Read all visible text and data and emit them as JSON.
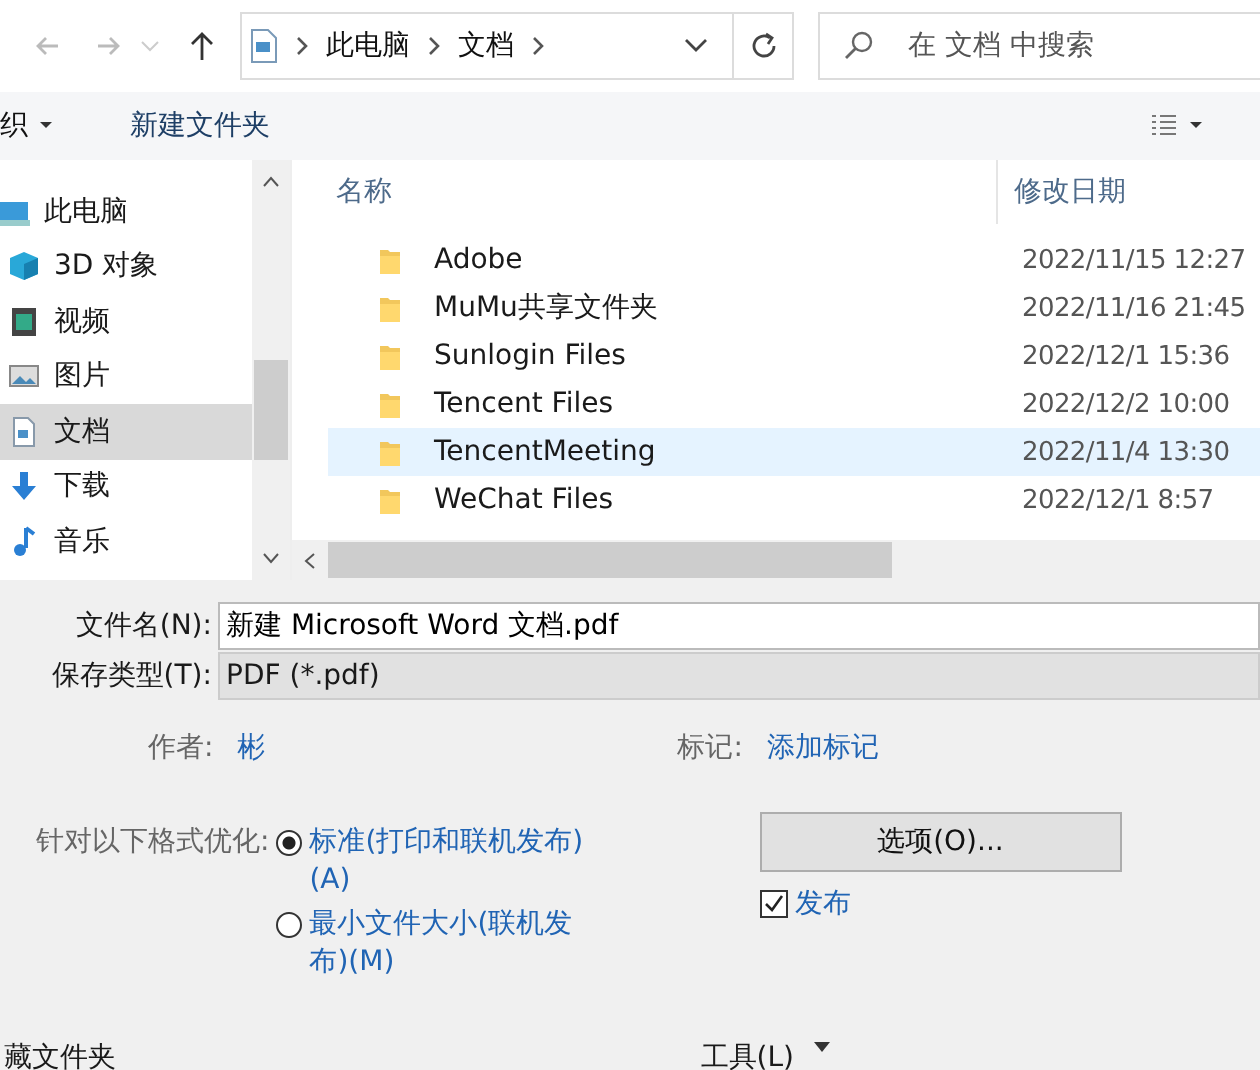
{
  "address_bar": {
    "path": [
      "此电脑",
      "文档"
    ],
    "search_placeholder": "在 文档 中搜索"
  },
  "toolbar": {
    "organize": "织",
    "new_folder": "新建文件夹"
  },
  "sidebar": {
    "items": [
      {
        "label": "此电脑",
        "kind": "pc",
        "selected": false
      },
      {
        "label": "3D 对象",
        "kind": "cube",
        "selected": false
      },
      {
        "label": "视频",
        "kind": "video",
        "selected": false
      },
      {
        "label": "图片",
        "kind": "image",
        "selected": false
      },
      {
        "label": "文档",
        "kind": "doc",
        "selected": true
      },
      {
        "label": "下载",
        "kind": "download",
        "selected": false
      },
      {
        "label": "音乐",
        "kind": "music",
        "selected": false
      }
    ]
  },
  "file_list": {
    "columns": [
      "名称",
      "修改日期"
    ],
    "rows": [
      {
        "name": "Adobe",
        "modified": "2022/11/15 12:27",
        "selected": false
      },
      {
        "name": "MuMu共享文件夹",
        "modified": "2022/11/16 21:45",
        "selected": false
      },
      {
        "name": "Sunlogin Files",
        "modified": "2022/12/1 15:36",
        "selected": false
      },
      {
        "name": "Tencent Files",
        "modified": "2022/12/2 10:00",
        "selected": false
      },
      {
        "name": "TencentMeeting",
        "modified": "2022/11/4 13:30",
        "selected": true
      },
      {
        "name": "WeChat Files",
        "modified": "2022/12/1 8:57",
        "selected": false
      }
    ]
  },
  "form": {
    "file_name_label": "文件名(N):",
    "file_name": "新建 Microsoft Word 文档.pdf",
    "type_label": "保存类型(T):",
    "type": "PDF (*.pdf)",
    "author_label": "作者:",
    "author": "彬",
    "tags_label": "标记:",
    "tags": "添加标记"
  },
  "optimize": {
    "label": "针对以下格式优化:",
    "options": [
      {
        "label": "标准(打印和联机发布)(A)",
        "selected": true
      },
      {
        "label": "最小文件大小(联机发布)(M)",
        "selected": false
      }
    ]
  },
  "options_button": "选项(O)...",
  "publish_checkbox": {
    "label": "发布",
    "checked": true
  },
  "footer": {
    "hide_folders": "藏文件夹",
    "tools": "工具(L)"
  }
}
